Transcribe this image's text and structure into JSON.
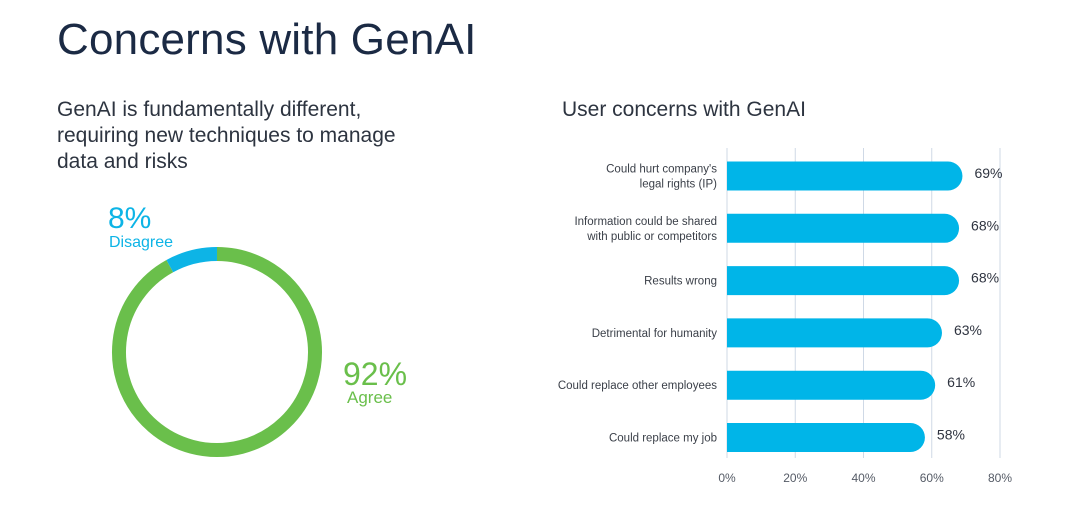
{
  "page": {
    "title": "Concerns with GenAI",
    "left_subtitle_lines": [
      "GenAI is fundamentally different,",
      "requiring new techniques to manage",
      "data and risks"
    ],
    "right_subtitle": "User concerns with GenAI"
  },
  "colors": {
    "title": "#1b2a44",
    "agree": "#6abf4b",
    "disagree": "#0db4e6",
    "bar": "#00b5e8",
    "grid": "#cfd9e6",
    "label": "#3a3f48"
  },
  "chart_data": [
    {
      "type": "pie",
      "donut": true,
      "title": "GenAI is fundamentally different, requiring new techniques to manage data and risks",
      "slices": [
        {
          "label": "Agree",
          "value": 92,
          "display": "92%",
          "color": "#6abf4b"
        },
        {
          "label": "Disagree",
          "value": 8,
          "display": "8%",
          "color": "#0db4e6"
        }
      ]
    },
    {
      "type": "bar",
      "orientation": "horizontal",
      "title": "User concerns with GenAI",
      "categories": [
        [
          "Could hurt company's",
          "legal rights (IP)"
        ],
        [
          "Information could be shared",
          "with public or competitors"
        ],
        [
          "Results wrong"
        ],
        [
          "Detrimental for humanity"
        ],
        [
          "Could replace other employees"
        ],
        [
          "Could replace my job"
        ]
      ],
      "values": [
        69,
        68,
        68,
        63,
        61,
        58
      ],
      "data_labels": [
        "69%",
        "68%",
        "68%",
        "63%",
        "61%",
        "58%"
      ],
      "xlim": [
        0,
        80
      ],
      "xticks": [
        0,
        20,
        40,
        60,
        80
      ],
      "xtick_labels": [
        "0%",
        "20%",
        "40%",
        "60%",
        "80%"
      ],
      "xlabel": "",
      "ylabel": "",
      "grid": true
    }
  ]
}
